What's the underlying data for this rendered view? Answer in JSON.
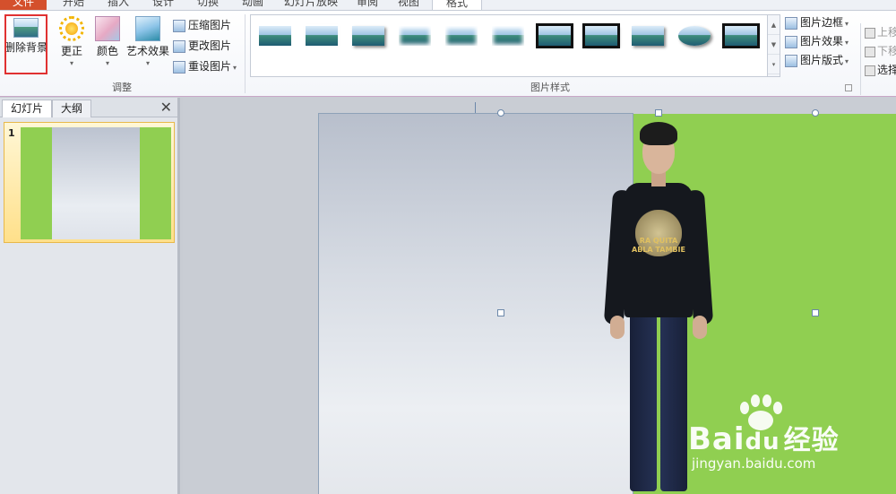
{
  "ribbon_tabs": [
    {
      "label": "文件"
    },
    {
      "label": "开始"
    },
    {
      "label": "插入"
    },
    {
      "label": "设计"
    },
    {
      "label": "切换"
    },
    {
      "label": "动画"
    },
    {
      "label": "幻灯片放映"
    },
    {
      "label": "审阅"
    },
    {
      "label": "视图"
    },
    {
      "label": "格式"
    }
  ],
  "adjust_group": {
    "remove_bg": "删除背景",
    "corrections": "更正",
    "color": "颜色",
    "artistic": "艺术效果",
    "compress": "压缩图片",
    "change": "更改图片",
    "reset": "重设图片",
    "label": "调整"
  },
  "styles_group": {
    "label": "图片样式",
    "border": "图片边框",
    "effects": "图片效果",
    "layout": "图片版式"
  },
  "arrange_group": {
    "bring_forward": "上移",
    "send_backward": "下移",
    "selection": "选择"
  },
  "left_pane": {
    "tab_slides": "幻灯片",
    "tab_outline": "大纲",
    "close_glyph": "✕",
    "slide_number": "1"
  },
  "shirt_text": {
    "line1": "RA QUITA",
    "line2": "ABLA TAMBIE"
  },
  "watermark": {
    "brand_a": "Bai",
    "brand_b": "du",
    "brand_c": "经验",
    "url": "jingyan.baidu.com"
  },
  "colors": {
    "slide_green": "#90cf51",
    "file_tab": "#d4502c",
    "highlight_red": "#e03131"
  }
}
